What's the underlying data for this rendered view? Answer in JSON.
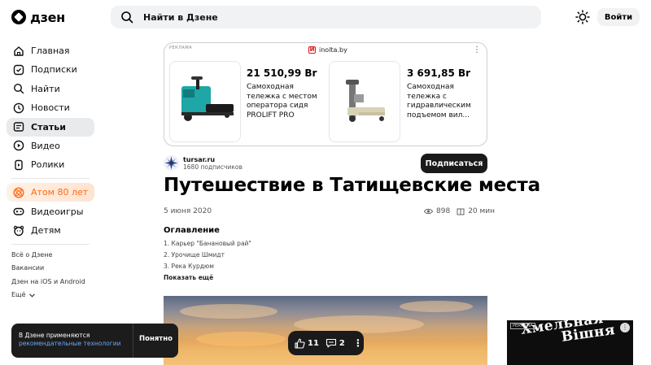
{
  "header": {
    "logo_text": "дзен",
    "search_placeholder": "Найти в Дзене",
    "login_label": "Войти"
  },
  "sidebar": {
    "items": [
      {
        "label": "Главная",
        "icon": "home-icon"
      },
      {
        "label": "Подписки",
        "icon": "subscriptions-icon"
      },
      {
        "label": "Найти",
        "icon": "search-icon"
      },
      {
        "label": "Новости",
        "icon": "news-icon"
      },
      {
        "label": "Статьи",
        "icon": "articles-icon",
        "active": true
      },
      {
        "label": "Видео",
        "icon": "video-icon"
      },
      {
        "label": "Ролики",
        "icon": "shorts-icon"
      }
    ],
    "extra_items": [
      {
        "label": "Атом 80 лет",
        "icon": "atom-icon"
      },
      {
        "label": "Видеоигры",
        "icon": "gamepad-icon"
      },
      {
        "label": "Детям",
        "icon": "kids-icon"
      }
    ],
    "footer_links": [
      "Всё о Дзене",
      "Вакансии",
      "Дзен на iOS и Android",
      "Ещё"
    ]
  },
  "ad": {
    "tag": "РЕКЛАМА",
    "source": "inolta.by",
    "products": [
      {
        "price": "21 510,99 Br",
        "description": "Самоходная тележка с местом оператора сидя PROLIFT PRO"
      },
      {
        "price": "3 691,85 Br",
        "description": "Самоходная тележка с гидравлическим подъемом вил..."
      }
    ]
  },
  "channel": {
    "name": "tursar.ru",
    "subscribers": "1680 подписчиков",
    "subscribe_label": "Подписаться"
  },
  "article": {
    "title": "Путешествие в Татищевские места",
    "date": "5 июня 2020",
    "views": "898",
    "read_time": "20 мин",
    "toc_title": "Оглавление",
    "toc": [
      "1. Карьер \"Банановый рай\"",
      "2. Урочище Шмидт",
      "3. Река Курдюм"
    ],
    "toc_more": "Показать ещё"
  },
  "reactions": {
    "likes": "11",
    "comments": "2"
  },
  "cookie_banner": {
    "text": "В Дзене применяются",
    "link": "рекомендательные технологии",
    "button": "Понятно"
  },
  "side_ad": {
    "tag": "РЕКЛАМА",
    "text_line1": "Хмельная",
    "text_line2": "Вішня"
  },
  "colors": {
    "accent_dark": "#1a1a1a",
    "promo_orange": "#ff6a13",
    "link_blue": "#6aa6ff"
  }
}
